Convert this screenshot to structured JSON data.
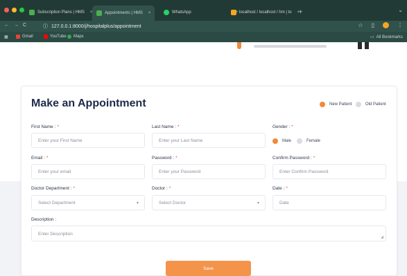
{
  "browser": {
    "tabs": [
      {
        "label": "Subscription Plans | HMS",
        "icon_color": "#4caf50"
      },
      {
        "label": "Appointments | HMS",
        "icon_color": "#4caf50"
      },
      {
        "label": "WhatsApp",
        "icon_color": "#25d366"
      },
      {
        "label": "localhost / localhost / hm | to",
        "icon_color": "#f6a623"
      }
    ],
    "url": "127.0.0.1:8000/j/hospitalplus/appointment",
    "bookmarks": [
      {
        "label": "Gmail",
        "icon_color": "#ea4335"
      },
      {
        "label": "YouTube",
        "icon_color": "#ff0000"
      },
      {
        "label": "Maps",
        "icon_color": "#34a853"
      }
    ],
    "all_bookmarks": "All Bookmarks"
  },
  "form": {
    "title": "Make an Appointment",
    "patient_types": [
      {
        "label": "New Patient",
        "selected": true
      },
      {
        "label": "Old Patient",
        "selected": false
      }
    ],
    "fields": {
      "first_name": {
        "label": "First Name :",
        "placeholder": "Enter your First Name"
      },
      "last_name": {
        "label": "Last Name :",
        "placeholder": "Enter your Last Name"
      },
      "gender": {
        "label": "Gender :",
        "options": [
          "Male",
          "Female"
        ],
        "selected": "Male"
      },
      "email": {
        "label": "Email :",
        "placeholder": "Enter your email"
      },
      "password": {
        "label": "Password :",
        "placeholder": "Enter your Password"
      },
      "confirm_password": {
        "label": "Confirm Password :",
        "placeholder": "Enter Confirm Password"
      },
      "department": {
        "label": "Doctor Department :",
        "placeholder": "Select Department"
      },
      "doctor": {
        "label": "Doctor :",
        "placeholder": "Select Doctor"
      },
      "date": {
        "label": "Date :",
        "placeholder": "Date"
      },
      "description": {
        "label": "Description :",
        "placeholder": "Enter Description"
      }
    },
    "required_mark": "*",
    "save_label": "Save"
  },
  "colors": {
    "accent": "#f08a3c",
    "title": "#1e2a4a",
    "browser": "#223a35"
  }
}
